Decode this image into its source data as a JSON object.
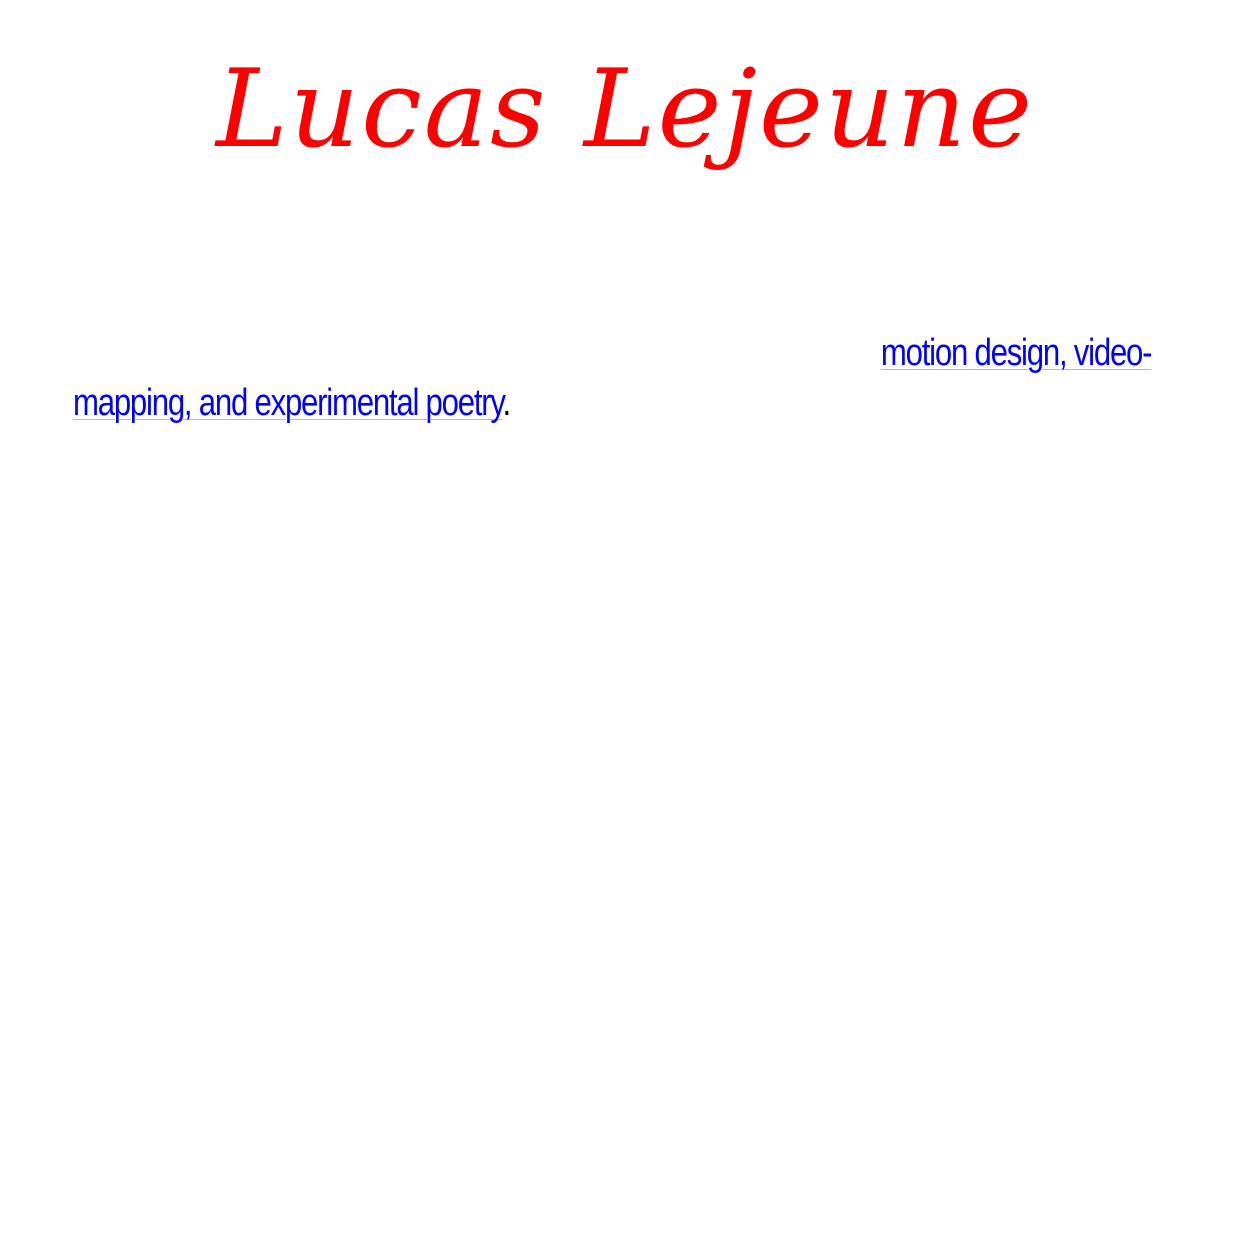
{
  "header": {
    "title": "Lucas Lejeune",
    "title_color": "#ff0000"
  },
  "bio": {
    "link_line_1": "motion design, video-",
    "link_line_2": "mapping, and experimental poetry",
    "trailing": ".",
    "link_color": "#0000ff"
  }
}
